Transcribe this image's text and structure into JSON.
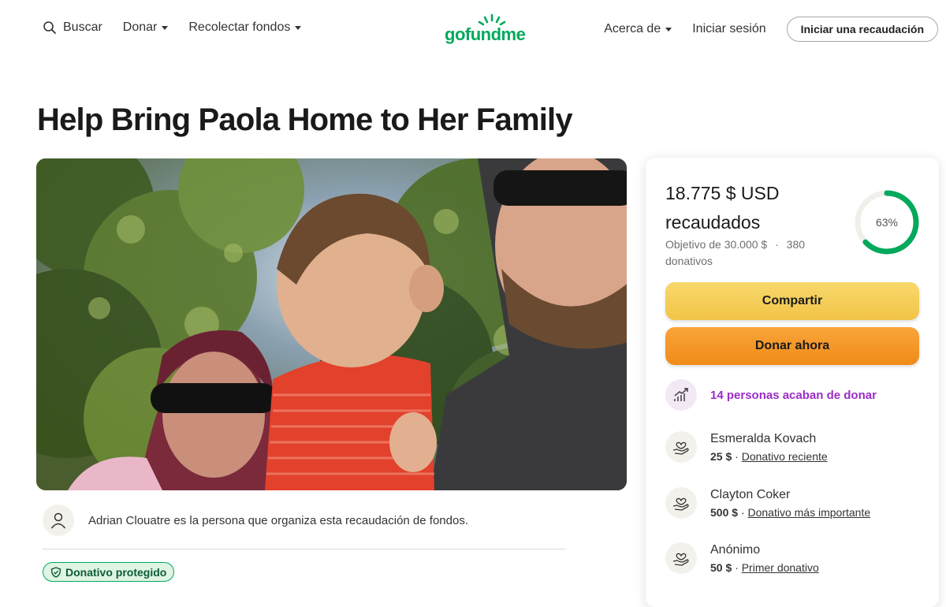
{
  "header": {
    "search_label": "Buscar",
    "donate_label": "Donar",
    "fundraise_label": "Recolectar fondos",
    "logo_text": "gofundme",
    "about_label": "Acerca de",
    "signin_label": "Iniciar sesión",
    "start_label": "Iniciar una recaudación"
  },
  "campaign": {
    "title": "Help Bring Paola Home to Her Family",
    "organizer_text": "Adrian Clouatre es la persona que organiza esta recaudación de fondos.",
    "protected_label": "Donativo protegido"
  },
  "progress": {
    "raised_amount": "18.775 $ USD",
    "raised_word": "recaudados",
    "goal_text": "Objetivo de 30.000 $",
    "dot": "·",
    "donations_text": "380 donativos",
    "percent_label": "63%",
    "fraction": 0.63
  },
  "actions": {
    "share_label": "Compartir",
    "donate_now_label": "Donar ahora"
  },
  "activity": {
    "recent_label": "14 personas acaban de donar"
  },
  "donations": [
    {
      "name": "Esmeralda Kovach",
      "amount": "25 $",
      "dot": "·",
      "tag": "Donativo reciente"
    },
    {
      "name": "Clayton Coker",
      "amount": "500 $",
      "dot": "·",
      "tag": "Donativo más importante"
    },
    {
      "name": "Anónimo",
      "amount": "50 $",
      "dot": "·",
      "tag": "Primer donativo"
    }
  ],
  "colors": {
    "brand": "#02a95c",
    "share": "#f2c447",
    "donate": "#f08b18",
    "recent": "#9b2cc7"
  }
}
